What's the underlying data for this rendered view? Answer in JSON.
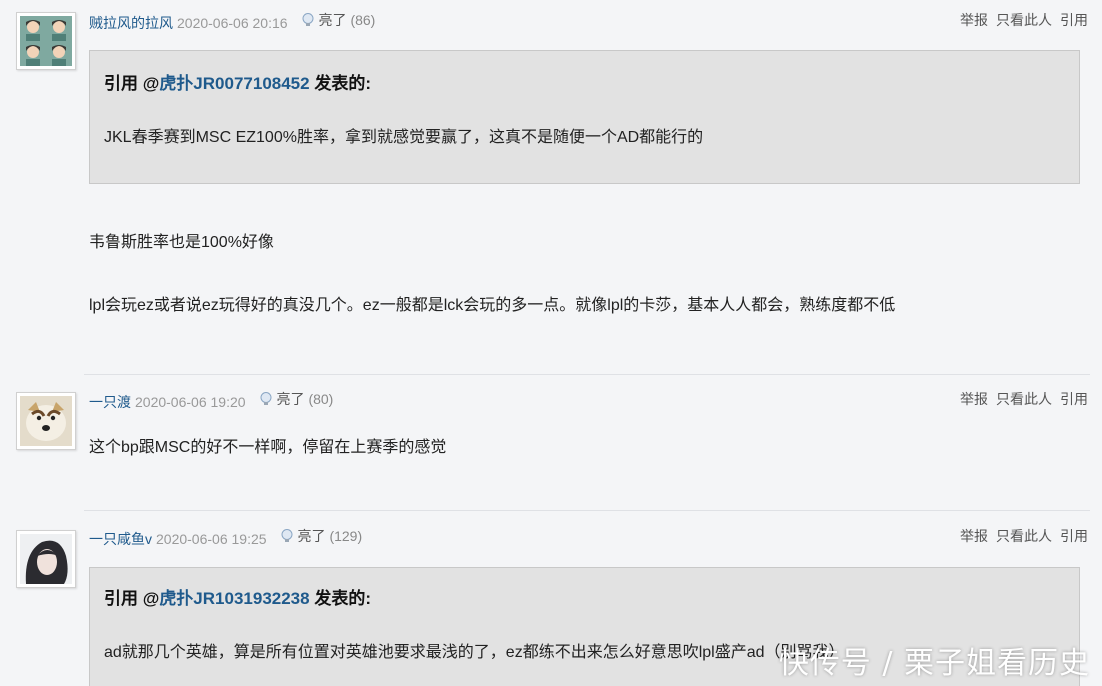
{
  "actions": {
    "report": "举报",
    "only_this": "只看此人",
    "quote": "引用"
  },
  "posts": [
    {
      "username": "贼拉风的拉风",
      "date": "2020-06-06 20:16",
      "light_label": "亮了",
      "light_count": "(86)",
      "quote": {
        "prefix": "引用 @",
        "user": "虎扑JR0077108452",
        "suffix": " 发表的:",
        "text": "JKL春季赛到MSC EZ100%胜率，拿到就感觉要赢了，这真不是随便一个AD都能行的"
      },
      "paragraphs": [
        "韦鲁斯胜率也是100%好像",
        "lpl会玩ez或者说ez玩得好的真没几个。ez一般都是lck会玩的多一点。就像lpl的卡莎，基本人人都会，熟练度都不低"
      ]
    },
    {
      "username": "一只渡",
      "date": "2020-06-06 19:20",
      "light_label": "亮了",
      "light_count": "(80)",
      "paragraphs": [
        "这个bp跟MSC的好不一样啊，停留在上赛季的感觉"
      ]
    },
    {
      "username": "一只咸鱼v",
      "date": "2020-06-06 19:25",
      "light_label": "亮了",
      "light_count": "(129)",
      "quote": {
        "prefix": "引用 @",
        "user": "虎扑JR1031932238",
        "suffix": " 发表的:",
        "text": "ad就那几个英雄，算是所有位置对英雄池要求最浅的了，ez都练不出来怎么好意思吹lpl盛产ad（别骂我）"
      }
    }
  ],
  "watermark": "快传号 / 栗子姐看历史",
  "icons": {
    "light": "lightbulb-icon"
  },
  "colors": {
    "username": "#1f5a8c",
    "quote_bg": "#e2e2e2",
    "page_bg": "#f4f5f7"
  }
}
